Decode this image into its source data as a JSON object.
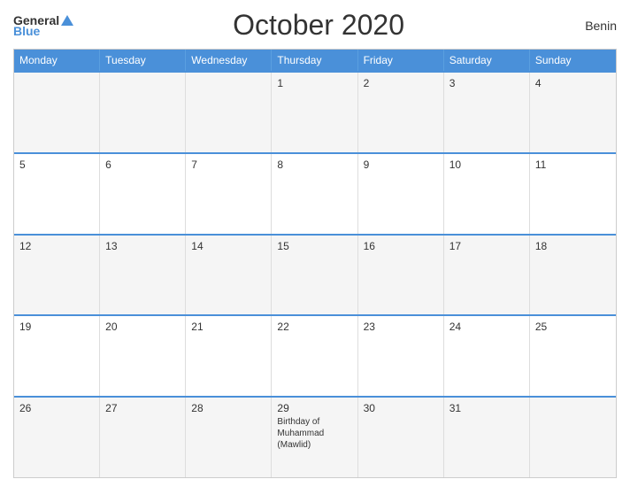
{
  "header": {
    "logo_general": "General",
    "logo_blue": "Blue",
    "title": "October 2020",
    "country": "Benin"
  },
  "calendar": {
    "days_of_week": [
      "Monday",
      "Tuesday",
      "Wednesday",
      "Thursday",
      "Friday",
      "Saturday",
      "Sunday"
    ],
    "weeks": [
      [
        {
          "day": "",
          "empty": true
        },
        {
          "day": "",
          "empty": true
        },
        {
          "day": "",
          "empty": true
        },
        {
          "day": "1",
          "empty": false
        },
        {
          "day": "2",
          "empty": false
        },
        {
          "day": "3",
          "empty": false
        },
        {
          "day": "4",
          "empty": false
        }
      ],
      [
        {
          "day": "5",
          "empty": false
        },
        {
          "day": "6",
          "empty": false
        },
        {
          "day": "7",
          "empty": false
        },
        {
          "day": "8",
          "empty": false
        },
        {
          "day": "9",
          "empty": false
        },
        {
          "day": "10",
          "empty": false
        },
        {
          "day": "11",
          "empty": false
        }
      ],
      [
        {
          "day": "12",
          "empty": false
        },
        {
          "day": "13",
          "empty": false
        },
        {
          "day": "14",
          "empty": false
        },
        {
          "day": "15",
          "empty": false
        },
        {
          "day": "16",
          "empty": false
        },
        {
          "day": "17",
          "empty": false
        },
        {
          "day": "18",
          "empty": false
        }
      ],
      [
        {
          "day": "19",
          "empty": false
        },
        {
          "day": "20",
          "empty": false
        },
        {
          "day": "21",
          "empty": false
        },
        {
          "day": "22",
          "empty": false
        },
        {
          "day": "23",
          "empty": false
        },
        {
          "day": "24",
          "empty": false
        },
        {
          "day": "25",
          "empty": false
        }
      ],
      [
        {
          "day": "26",
          "empty": false
        },
        {
          "day": "27",
          "empty": false
        },
        {
          "day": "28",
          "empty": false
        },
        {
          "day": "29",
          "empty": false,
          "event": "Birthday of Muhammad (Mawlid)"
        },
        {
          "day": "30",
          "empty": false
        },
        {
          "day": "31",
          "empty": false
        },
        {
          "day": "",
          "empty": true
        }
      ]
    ]
  }
}
